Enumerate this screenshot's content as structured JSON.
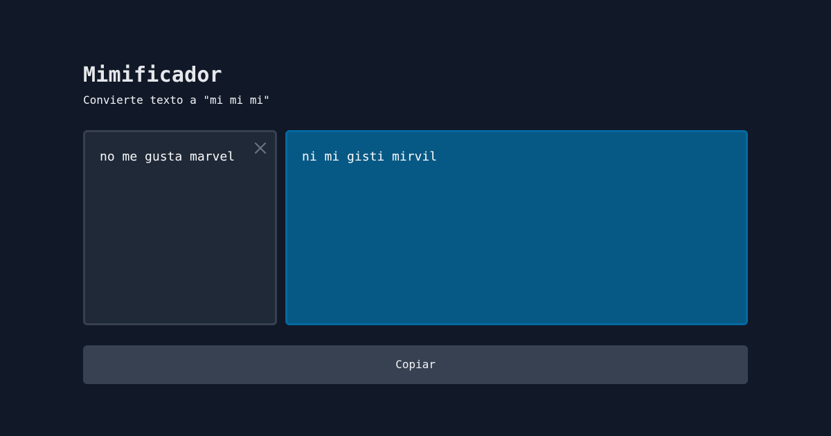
{
  "header": {
    "title": "Mimificador",
    "subtitle": "Convierte texto a \"mi mi mi\""
  },
  "input": {
    "value": "no me gusta marvel",
    "clear_icon": "close-icon"
  },
  "output": {
    "value": "ni mi gisti mirvil"
  },
  "actions": {
    "copy_label": "Copiar"
  },
  "colors": {
    "background": "#111827",
    "input_bg": "#1f2937",
    "input_border": "#374151",
    "output_bg": "#075985",
    "output_border": "#0369a1",
    "button_bg": "#374151"
  }
}
